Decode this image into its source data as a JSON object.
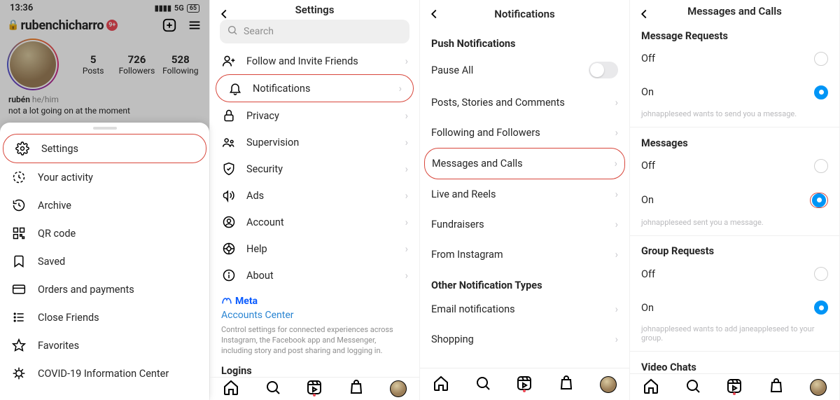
{
  "panel1": {
    "status": {
      "time": "13:36",
      "signal_label": "5G",
      "battery": "65"
    },
    "profile": {
      "username": "rubenchicharro",
      "badge": "9+",
      "name": "rubén",
      "pronouns": "he/him",
      "bio_line": "not a lot going on at the moment",
      "stats": [
        {
          "num": "5",
          "label": "Posts"
        },
        {
          "num": "726",
          "label": "Followers"
        },
        {
          "num": "528",
          "label": "Following"
        }
      ]
    },
    "menu": [
      {
        "label": "Settings",
        "icon": "gear",
        "highlight": true
      },
      {
        "label": "Your activity",
        "icon": "activity"
      },
      {
        "label": "Archive",
        "icon": "archive"
      },
      {
        "label": "QR code",
        "icon": "qr"
      },
      {
        "label": "Saved",
        "icon": "bookmark"
      },
      {
        "label": "Orders and payments",
        "icon": "card"
      },
      {
        "label": "Close Friends",
        "icon": "list"
      },
      {
        "label": "Favorites",
        "icon": "star"
      },
      {
        "label": "COVID-19 Information Center",
        "icon": "covid"
      }
    ]
  },
  "panel2": {
    "title": "Settings",
    "search_placeholder": "Search",
    "items": [
      {
        "label": "Follow and Invite Friends",
        "icon": "person-plus"
      },
      {
        "label": "Notifications",
        "icon": "bell",
        "highlight": true
      },
      {
        "label": "Privacy",
        "icon": "lock"
      },
      {
        "label": "Supervision",
        "icon": "supervise"
      },
      {
        "label": "Security",
        "icon": "shield"
      },
      {
        "label": "Ads",
        "icon": "megaphone"
      },
      {
        "label": "Account",
        "icon": "account"
      },
      {
        "label": "Help",
        "icon": "help"
      },
      {
        "label": "About",
        "icon": "info"
      }
    ],
    "meta": {
      "brand": "Meta",
      "link": "Accounts Center",
      "desc": "Control settings for connected experiences across Instagram, the Facebook app and Messenger, including story and post sharing and logging in."
    },
    "logins_title": "Logins"
  },
  "panel3": {
    "title": "Notifications",
    "push_header": "Push Notifications",
    "items_push": [
      {
        "label": "Pause All",
        "type": "switch"
      },
      {
        "label": "Posts, Stories and Comments",
        "type": "link"
      },
      {
        "label": "Following and Followers",
        "type": "link"
      },
      {
        "label": "Messages and Calls",
        "type": "link",
        "highlight": true
      },
      {
        "label": "Live and Reels",
        "type": "link"
      },
      {
        "label": "Fundraisers",
        "type": "link"
      },
      {
        "label": "From Instagram",
        "type": "link"
      }
    ],
    "other_header": "Other Notification Types",
    "items_other": [
      {
        "label": "Email notifications",
        "type": "link"
      },
      {
        "label": "Shopping",
        "type": "link"
      }
    ]
  },
  "panel4": {
    "title": "Messages and Calls",
    "sections": [
      {
        "title": "Message Requests",
        "options": [
          {
            "label": "Off",
            "on": false
          },
          {
            "label": "On",
            "on": true
          }
        ],
        "hint": "johnappleseed wants to send you a message."
      },
      {
        "title": "Messages",
        "options": [
          {
            "label": "Off",
            "on": false
          },
          {
            "label": "On",
            "on": true,
            "highlight": true
          }
        ],
        "hint": "johnappleseed sent you a message."
      },
      {
        "title": "Group Requests",
        "options": [
          {
            "label": "Off",
            "on": false
          },
          {
            "label": "On",
            "on": true
          }
        ],
        "hint": "johnappleseed wants to add janeappleseed to your group."
      },
      {
        "title": "Video Chats",
        "options": [],
        "hint": ""
      }
    ]
  }
}
